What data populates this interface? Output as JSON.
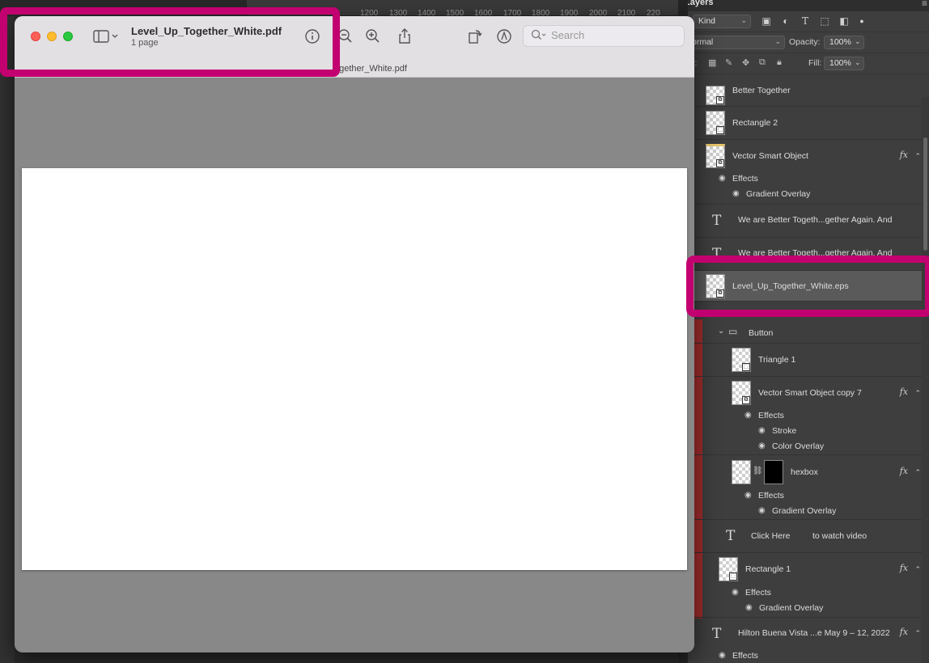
{
  "ruler": {
    "ticks": [
      "1200",
      "1300",
      "1400",
      "1500",
      "1600",
      "1700",
      "1800",
      "1900",
      "2000",
      "2100",
      "220"
    ]
  },
  "preview": {
    "title": "Level_Up_Together_White.pdf",
    "pages": "1 page",
    "tab_title": "ogether_White.pdf",
    "search_placeholder": "Search",
    "icons": [
      "sidebar-icon",
      "info-icon",
      "zoom-out-icon",
      "zoom-in-icon",
      "share-icon",
      "rotate-icon",
      "markup-icon",
      "search-icon"
    ]
  },
  "layers_panel": {
    "tab_label": "Layers",
    "filter_kind": "Kind",
    "blend_mode": "ormal",
    "opacity_label": "Opacity:",
    "opacity_value": "100%",
    "lock_label": "ck:",
    "fill_label": "Fill:",
    "fill_value": "100%",
    "layers": [
      {
        "name": "Better Together"
      },
      {
        "name": "Rectangle 2"
      },
      {
        "name": "Vector Smart Object",
        "effects_label": "Effects",
        "effects": [
          "Gradient Overlay"
        ]
      },
      {
        "name": "We are Better Togeth...gether Again.  And"
      },
      {
        "name": "We are Better Togeth...gether Again.  And"
      },
      {
        "name": "Level_Up_Together_White.eps"
      },
      {
        "name": "Button"
      },
      {
        "name": "Triangle 1"
      },
      {
        "name": "Vector Smart Object copy 7",
        "effects_label": "Effects",
        "effects": [
          "Stroke",
          "Color Overlay"
        ]
      },
      {
        "name": "hexbox",
        "effects_label": "Effects",
        "effects": [
          "Gradient Overlay"
        ]
      },
      {
        "name": "Click Here",
        "name2": "to watch video"
      },
      {
        "name": "Rectangle 1",
        "effects_label": "Effects",
        "effects": [
          "Gradient Overlay"
        ]
      },
      {
        "name": "Hilton Buena Vista ...e May 9 – 12, 2022",
        "effects_label": "Effects"
      }
    ],
    "fx_label": "fx"
  },
  "colors": {
    "highlight": "#c2006f",
    "panel": "#3e3e3e",
    "red_bar": "#a32c2c"
  }
}
